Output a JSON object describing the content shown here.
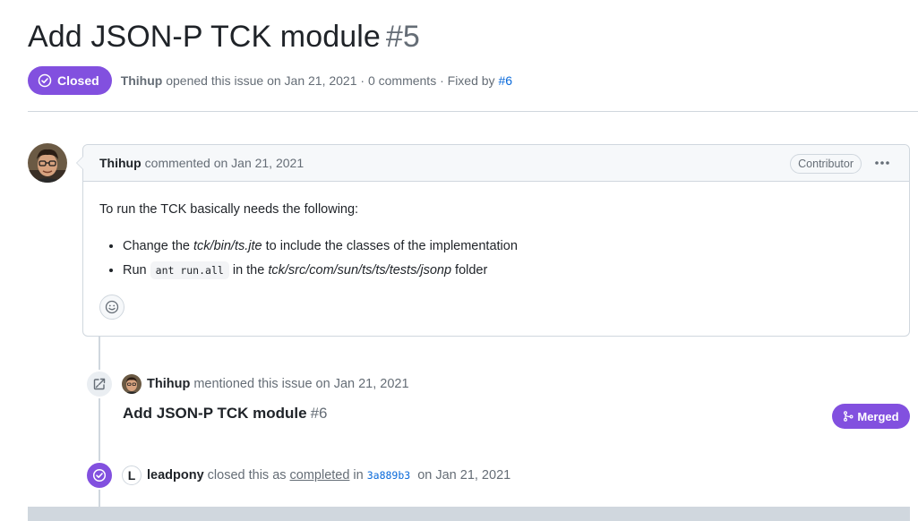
{
  "issue": {
    "title": "Add JSON-P TCK module",
    "number": "#5",
    "state_label": "Closed",
    "author": "Thihup",
    "opened_text": "opened this issue on Jan 21, 2021 · 0 comments · Fixed by",
    "fixed_by": "#6"
  },
  "comment": {
    "author": "Thihup",
    "timestamp": "commented on Jan 21, 2021",
    "role_badge": "Contributor",
    "more_icon": "kebab-horizontal-icon",
    "intro": "To run the TCK basically needs the following:",
    "bullets": [
      {
        "pre": "Change the ",
        "em": "tck/bin/ts.jte",
        "post": " to include the classes of the implementation"
      },
      {
        "pre": "Run ",
        "code": "ant run.all",
        "mid": " in the ",
        "em": "tck/src/com/sun/ts/ts/tests/jsonp",
        "post": " folder"
      }
    ],
    "reaction_icon": "smiley-icon"
  },
  "events": {
    "mention": {
      "actor": "Thihup",
      "text": "mentioned this issue on Jan 21, 2021",
      "pr_title": "Add JSON-P TCK module",
      "pr_number": "#6",
      "pr_state": "Merged"
    },
    "closed": {
      "avatar_letter": "L",
      "actor": "leadpony",
      "text_pre": "closed this as",
      "link": "completed",
      "text_in": "in",
      "sha": "3a889b3",
      "text_post": "on Jan 21, 2021"
    }
  },
  "colors": {
    "closed_purple": "#8250df",
    "link_blue": "#0969da",
    "muted": "#656d76",
    "border": "#d0d7de"
  }
}
